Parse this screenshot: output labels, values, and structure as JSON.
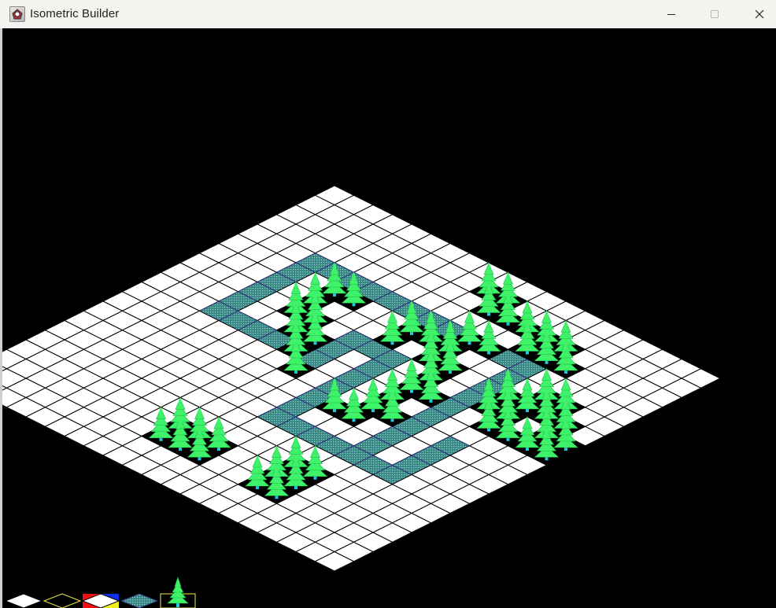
{
  "window": {
    "title": "Isometric Builder",
    "icon": "app-icon",
    "controls": [
      "minimize-icon",
      "maximize-icon",
      "close-icon"
    ]
  },
  "map": {
    "rows": 20,
    "cols": 20,
    "tile_types": [
      "grass",
      "path",
      "tree"
    ],
    "colors": {
      "background": "#000000",
      "tile": "#ffffff",
      "grid": "#000000",
      "path": "#3f8f8c",
      "path_edge": "#2b2f78",
      "tree": "#3ef26a",
      "tree_dark": "#1fb84a",
      "trunk": "#1ec8e0"
    },
    "paths": [
      [
        [
          3,
          4
        ],
        [
          4,
          4
        ],
        [
          5,
          4
        ],
        [
          6,
          4
        ],
        [
          7,
          4
        ],
        [
          8,
          4
        ],
        [
          9,
          4
        ],
        [
          10,
          4
        ],
        [
          11,
          4
        ],
        [
          12,
          4
        ],
        [
          13,
          4
        ],
        [
          14,
          4
        ]
      ],
      [
        [
          3,
          5
        ],
        [
          3,
          6
        ],
        [
          3,
          7
        ],
        [
          3,
          8
        ],
        [
          3,
          9
        ]
      ],
      [
        [
          4,
          9
        ],
        [
          5,
          9
        ],
        [
          6,
          9
        ],
        [
          7,
          9
        ],
        [
          8,
          9
        ]
      ],
      [
        [
          8,
          8
        ],
        [
          8,
          7
        ],
        [
          9,
          7
        ],
        [
          10,
          7
        ],
        [
          10,
          8
        ],
        [
          10,
          9
        ],
        [
          10,
          10
        ],
        [
          10,
          11
        ],
        [
          10,
          12
        ],
        [
          10,
          13
        ]
      ],
      [
        [
          11,
          13
        ],
        [
          12,
          13
        ],
        [
          13,
          13
        ],
        [
          14,
          13
        ],
        [
          15,
          13
        ],
        [
          16,
          13
        ]
      ],
      [
        [
          14,
          5
        ],
        [
          14,
          6
        ],
        [
          14,
          7
        ],
        [
          14,
          8
        ],
        [
          14,
          9
        ],
        [
          14,
          10
        ],
        [
          14,
          11
        ],
        [
          14,
          12
        ],
        [
          14,
          13
        ]
      ],
      [
        [
          16,
          10
        ],
        [
          16,
          11
        ],
        [
          16,
          12
        ],
        [
          15,
          13
        ]
      ]
    ],
    "trees": [
      [
        5,
        5
      ],
      [
        6,
        5
      ],
      [
        5,
        6
      ],
      [
        5,
        7
      ],
      [
        6,
        7
      ],
      [
        6,
        8
      ],
      [
        7,
        8
      ],
      [
        7,
        9
      ],
      [
        8,
        10
      ],
      [
        9,
        5
      ],
      [
        9,
        6
      ],
      [
        10,
        5
      ],
      [
        11,
        5
      ],
      [
        11,
        6
      ],
      [
        12,
        6
      ],
      [
        12,
        7
      ],
      [
        12,
        8
      ],
      [
        13,
        8
      ],
      [
        12,
        9
      ],
      [
        12,
        10
      ],
      [
        13,
        10
      ],
      [
        12,
        11
      ],
      [
        11,
        11
      ],
      [
        15,
        6
      ],
      [
        15,
        7
      ],
      [
        16,
        7
      ],
      [
        16,
        8
      ],
      [
        17,
        8
      ],
      [
        13,
        15
      ],
      [
        14,
        15
      ],
      [
        13,
        16
      ],
      [
        14,
        16
      ],
      [
        13,
        17
      ],
      [
        14,
        17
      ],
      [
        9,
        1
      ],
      [
        10,
        1
      ],
      [
        10,
        2
      ],
      [
        11,
        2
      ],
      [
        12,
        2
      ],
      [
        13,
        2
      ],
      [
        13,
        3
      ],
      [
        14,
        3
      ],
      [
        14,
        2
      ],
      [
        15,
        3
      ],
      [
        12,
        4
      ],
      [
        11,
        4
      ],
      [
        16,
        5
      ],
      [
        16,
        6
      ],
      [
        17,
        6
      ],
      [
        17,
        5
      ],
      [
        18,
        6
      ],
      [
        18,
        7
      ],
      [
        19,
        7
      ],
      [
        19,
        8
      ],
      [
        18,
        8
      ],
      [
        8,
        17
      ],
      [
        9,
        17
      ],
      [
        9,
        16
      ],
      [
        8,
        16
      ],
      [
        10,
        17
      ],
      [
        10,
        16
      ]
    ]
  },
  "palette": {
    "items": [
      {
        "name": "grass-tile-swatch",
        "kind": "grass"
      },
      {
        "name": "empty-tile-swatch",
        "kind": "outline"
      },
      {
        "name": "color-tile-swatch",
        "kind": "color"
      },
      {
        "name": "path-tile-swatch",
        "kind": "path"
      },
      {
        "name": "tree-tile-swatch",
        "kind": "tree",
        "selected": true
      }
    ],
    "selected_color": "#f0f040"
  }
}
